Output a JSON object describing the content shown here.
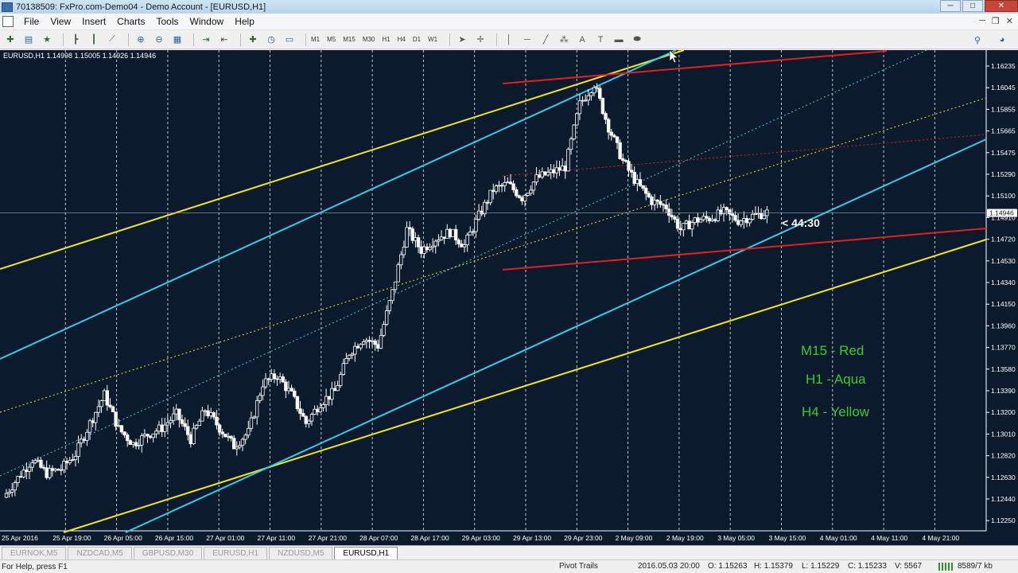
{
  "window": {
    "title": "70138509: FxPro.com-Demo04 - Demo Account - [EURUSD,H1]",
    "min": "─",
    "max": "□",
    "close": "✕"
  },
  "menu": [
    "File",
    "View",
    "Insert",
    "Charts",
    "Tools",
    "Window",
    "Help"
  ],
  "menu_right": {
    "minimize": "─",
    "restore": "❐",
    "close": "✕"
  },
  "toolbar": {
    "timeframes": [
      "M1",
      "M5",
      "M15",
      "M30",
      "H1",
      "H4",
      "D1",
      "W1"
    ],
    "text_tool": "A"
  },
  "chart": {
    "symbol_info": "EURUSD,H1  1.14998 1.15005 1.14926 1.14946",
    "countdown": "< 44:30",
    "current_price": "1.14946",
    "legend": [
      "M15 - Red",
      "H1 - Aqua",
      "H4 - Yellow"
    ],
    "colors": {
      "background": "#0c1a2d",
      "red": "#e51e1e",
      "aqua": "#33ccee",
      "yellow": "#f2e61c",
      "legend_text": "#33cc33",
      "candles": "#ffffff"
    }
  },
  "chart_data": {
    "type": "candlestick",
    "price_labels": [
      "1.16235",
      "1.16045",
      "1.15855",
      "1.15665",
      "1.15475",
      "1.15290",
      "1.15100",
      "1.14910",
      "1.14720",
      "1.14530",
      "1.14340",
      "1.14150",
      "1.13960",
      "1.13770",
      "1.13580",
      "1.13390",
      "1.13200",
      "1.13010",
      "1.12820",
      "1.12630",
      "1.12440",
      "1.12250"
    ],
    "time_labels": [
      "25 Apr 2016",
      "25 Apr 19:00",
      "26 Apr 05:00",
      "26 Apr 15:00",
      "27 Apr 01:00",
      "27 Apr 11:00",
      "27 Apr 21:00",
      "28 Apr 07:00",
      "28 Apr 17:00",
      "29 Apr 03:00",
      "29 Apr 13:00",
      "29 Apr 23:00",
      "2 May 09:00",
      "2 May 19:00",
      "3 May 05:00",
      "3 May 15:00",
      "4 May 01:00",
      "4 May 11:00",
      "4 May 21:00"
    ],
    "close_series": [
      1.1245,
      1.1262,
      1.1278,
      1.1266,
      1.127,
      1.1283,
      1.131,
      1.1335,
      1.1305,
      1.1292,
      1.13,
      1.1306,
      1.1318,
      1.1296,
      1.1322,
      1.1306,
      1.129,
      1.1302,
      1.1345,
      1.1352,
      1.1335,
      1.131,
      1.1328,
      1.1338,
      1.1372,
      1.1385,
      1.1378,
      1.1425,
      1.148,
      1.1462,
      1.1472,
      1.1478,
      1.1466,
      1.1492,
      1.1515,
      1.152,
      1.1508,
      1.1525,
      1.153,
      1.1535,
      1.159,
      1.1608,
      1.157,
      1.154,
      1.152,
      1.1505,
      1.15,
      1.148,
      1.1488,
      1.149,
      1.1495,
      1.1488,
      1.1492,
      1.1495
    ]
  },
  "tabs": [
    "EURNOK,M5",
    "NZDCAD,M5",
    "GBPUSD,M30",
    "EURUSD,H1",
    "NZDUSD,M5",
    "EURUSD,H1"
  ],
  "active_tab": 5,
  "status": {
    "help": "For Help, press F1",
    "profile": "Pivot Trails",
    "datetime": "2016.05.03 20:00",
    "open": "O: 1.15263",
    "high": "H: 1.15379",
    "low": "L: 1.15229",
    "close": "C: 1.15233",
    "volume": "V: 5567",
    "traffic": "8589/7 kb"
  }
}
